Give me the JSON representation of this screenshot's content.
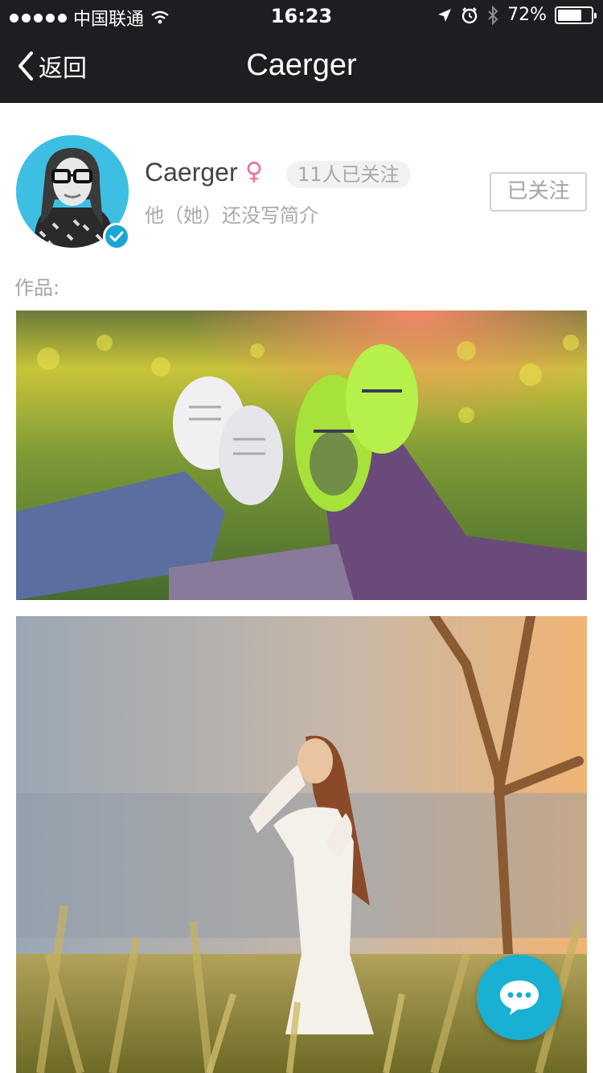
{
  "status_bar": {
    "carrier": "中国联通",
    "time": "16:23",
    "battery_text": "72%",
    "battery_level": 0.72
  },
  "nav": {
    "back_label": "返回",
    "title": "Caerger"
  },
  "profile": {
    "name": "Caerger",
    "gender_symbol": "♀",
    "followers": "11人已关注",
    "bio": "他（她）还没写简介",
    "follow_button": "已关注"
  },
  "works": {
    "label": "作品:"
  },
  "colors": {
    "nav_bg": "#1e1e22",
    "accent": "#1ab0d3",
    "gender": "#ec6ea4"
  },
  "icons": {
    "back": "chevron-left-icon",
    "chat": "chat-bubble-icon",
    "verified": "check-icon"
  }
}
